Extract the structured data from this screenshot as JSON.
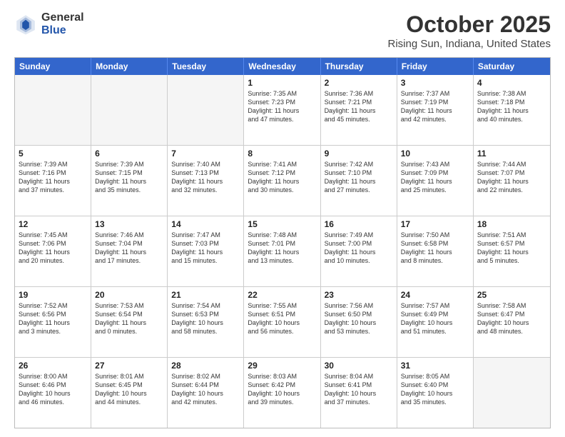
{
  "logo": {
    "general": "General",
    "blue": "Blue"
  },
  "header": {
    "month": "October 2025",
    "location": "Rising Sun, Indiana, United States"
  },
  "days_of_week": [
    "Sunday",
    "Monday",
    "Tuesday",
    "Wednesday",
    "Thursday",
    "Friday",
    "Saturday"
  ],
  "weeks": [
    [
      {
        "day": "",
        "text": "",
        "empty": true
      },
      {
        "day": "",
        "text": "",
        "empty": true
      },
      {
        "day": "",
        "text": "",
        "empty": true
      },
      {
        "day": "1",
        "text": "Sunrise: 7:35 AM\nSunset: 7:23 PM\nDaylight: 11 hours\nand 47 minutes.",
        "empty": false
      },
      {
        "day": "2",
        "text": "Sunrise: 7:36 AM\nSunset: 7:21 PM\nDaylight: 11 hours\nand 45 minutes.",
        "empty": false
      },
      {
        "day": "3",
        "text": "Sunrise: 7:37 AM\nSunset: 7:19 PM\nDaylight: 11 hours\nand 42 minutes.",
        "empty": false
      },
      {
        "day": "4",
        "text": "Sunrise: 7:38 AM\nSunset: 7:18 PM\nDaylight: 11 hours\nand 40 minutes.",
        "empty": false
      }
    ],
    [
      {
        "day": "5",
        "text": "Sunrise: 7:39 AM\nSunset: 7:16 PM\nDaylight: 11 hours\nand 37 minutes.",
        "empty": false
      },
      {
        "day": "6",
        "text": "Sunrise: 7:39 AM\nSunset: 7:15 PM\nDaylight: 11 hours\nand 35 minutes.",
        "empty": false
      },
      {
        "day": "7",
        "text": "Sunrise: 7:40 AM\nSunset: 7:13 PM\nDaylight: 11 hours\nand 32 minutes.",
        "empty": false
      },
      {
        "day": "8",
        "text": "Sunrise: 7:41 AM\nSunset: 7:12 PM\nDaylight: 11 hours\nand 30 minutes.",
        "empty": false
      },
      {
        "day": "9",
        "text": "Sunrise: 7:42 AM\nSunset: 7:10 PM\nDaylight: 11 hours\nand 27 minutes.",
        "empty": false
      },
      {
        "day": "10",
        "text": "Sunrise: 7:43 AM\nSunset: 7:09 PM\nDaylight: 11 hours\nand 25 minutes.",
        "empty": false
      },
      {
        "day": "11",
        "text": "Sunrise: 7:44 AM\nSunset: 7:07 PM\nDaylight: 11 hours\nand 22 minutes.",
        "empty": false
      }
    ],
    [
      {
        "day": "12",
        "text": "Sunrise: 7:45 AM\nSunset: 7:06 PM\nDaylight: 11 hours\nand 20 minutes.",
        "empty": false
      },
      {
        "day": "13",
        "text": "Sunrise: 7:46 AM\nSunset: 7:04 PM\nDaylight: 11 hours\nand 17 minutes.",
        "empty": false
      },
      {
        "day": "14",
        "text": "Sunrise: 7:47 AM\nSunset: 7:03 PM\nDaylight: 11 hours\nand 15 minutes.",
        "empty": false
      },
      {
        "day": "15",
        "text": "Sunrise: 7:48 AM\nSunset: 7:01 PM\nDaylight: 11 hours\nand 13 minutes.",
        "empty": false
      },
      {
        "day": "16",
        "text": "Sunrise: 7:49 AM\nSunset: 7:00 PM\nDaylight: 11 hours\nand 10 minutes.",
        "empty": false
      },
      {
        "day": "17",
        "text": "Sunrise: 7:50 AM\nSunset: 6:58 PM\nDaylight: 11 hours\nand 8 minutes.",
        "empty": false
      },
      {
        "day": "18",
        "text": "Sunrise: 7:51 AM\nSunset: 6:57 PM\nDaylight: 11 hours\nand 5 minutes.",
        "empty": false
      }
    ],
    [
      {
        "day": "19",
        "text": "Sunrise: 7:52 AM\nSunset: 6:56 PM\nDaylight: 11 hours\nand 3 minutes.",
        "empty": false
      },
      {
        "day": "20",
        "text": "Sunrise: 7:53 AM\nSunset: 6:54 PM\nDaylight: 11 hours\nand 0 minutes.",
        "empty": false
      },
      {
        "day": "21",
        "text": "Sunrise: 7:54 AM\nSunset: 6:53 PM\nDaylight: 10 hours\nand 58 minutes.",
        "empty": false
      },
      {
        "day": "22",
        "text": "Sunrise: 7:55 AM\nSunset: 6:51 PM\nDaylight: 10 hours\nand 56 minutes.",
        "empty": false
      },
      {
        "day": "23",
        "text": "Sunrise: 7:56 AM\nSunset: 6:50 PM\nDaylight: 10 hours\nand 53 minutes.",
        "empty": false
      },
      {
        "day": "24",
        "text": "Sunrise: 7:57 AM\nSunset: 6:49 PM\nDaylight: 10 hours\nand 51 minutes.",
        "empty": false
      },
      {
        "day": "25",
        "text": "Sunrise: 7:58 AM\nSunset: 6:47 PM\nDaylight: 10 hours\nand 48 minutes.",
        "empty": false
      }
    ],
    [
      {
        "day": "26",
        "text": "Sunrise: 8:00 AM\nSunset: 6:46 PM\nDaylight: 10 hours\nand 46 minutes.",
        "empty": false
      },
      {
        "day": "27",
        "text": "Sunrise: 8:01 AM\nSunset: 6:45 PM\nDaylight: 10 hours\nand 44 minutes.",
        "empty": false
      },
      {
        "day": "28",
        "text": "Sunrise: 8:02 AM\nSunset: 6:44 PM\nDaylight: 10 hours\nand 42 minutes.",
        "empty": false
      },
      {
        "day": "29",
        "text": "Sunrise: 8:03 AM\nSunset: 6:42 PM\nDaylight: 10 hours\nand 39 minutes.",
        "empty": false
      },
      {
        "day": "30",
        "text": "Sunrise: 8:04 AM\nSunset: 6:41 PM\nDaylight: 10 hours\nand 37 minutes.",
        "empty": false
      },
      {
        "day": "31",
        "text": "Sunrise: 8:05 AM\nSunset: 6:40 PM\nDaylight: 10 hours\nand 35 minutes.",
        "empty": false
      },
      {
        "day": "",
        "text": "",
        "empty": true
      }
    ]
  ]
}
